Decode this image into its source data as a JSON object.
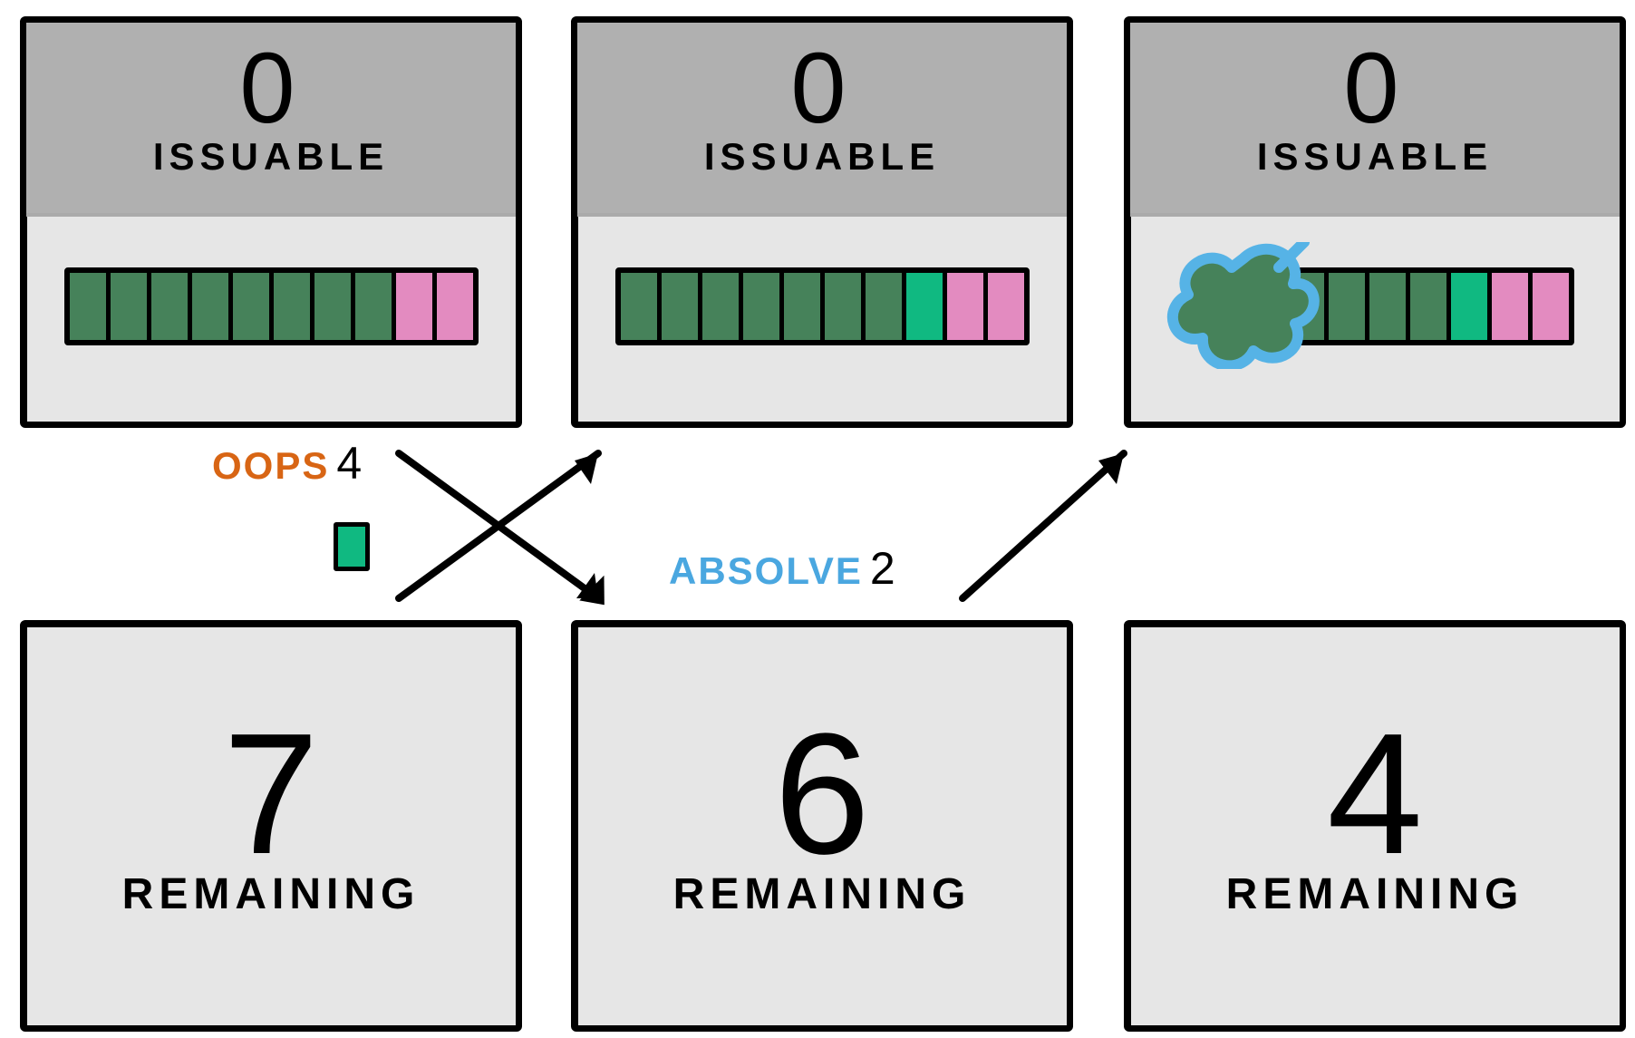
{
  "top_panels": [
    {
      "value": "0",
      "label": "ISSUABLE",
      "bar": [
        "dgreen",
        "dgreen",
        "dgreen",
        "dgreen",
        "dgreen",
        "dgreen",
        "dgreen",
        "dgreen",
        "pink",
        "pink"
      ],
      "has_puff": false
    },
    {
      "value": "0",
      "label": "ISSUABLE",
      "bar": [
        "dgreen",
        "dgreen",
        "dgreen",
        "dgreen",
        "dgreen",
        "dgreen",
        "dgreen",
        "bgreen",
        "pink",
        "pink"
      ],
      "has_puff": false
    },
    {
      "value": "0",
      "label": "ISSUABLE",
      "bar": [
        "dgreen",
        "dgreen",
        "dgreen",
        "dgreen",
        "dgreen",
        "bgreen",
        "pink",
        "pink"
      ],
      "has_puff": true
    }
  ],
  "bottom_panels": [
    {
      "value": "7",
      "label": "REMAINING"
    },
    {
      "value": "6",
      "label": "REMAINING"
    },
    {
      "value": "4",
      "label": "REMAINING"
    }
  ],
  "annotations": {
    "oops_label": "OOPS",
    "oops_value": "4",
    "absolve_label": "ABSOLVE",
    "absolve_value": "2"
  },
  "colors": {
    "dgreen": "#46825a",
    "bgreen": "#10b981",
    "pink": "#e38bc0",
    "oops": "#d86514",
    "absolve": "#4aa7e0",
    "panel_bg": "#e6e6e6",
    "header_bg": "#b0b0b0"
  }
}
